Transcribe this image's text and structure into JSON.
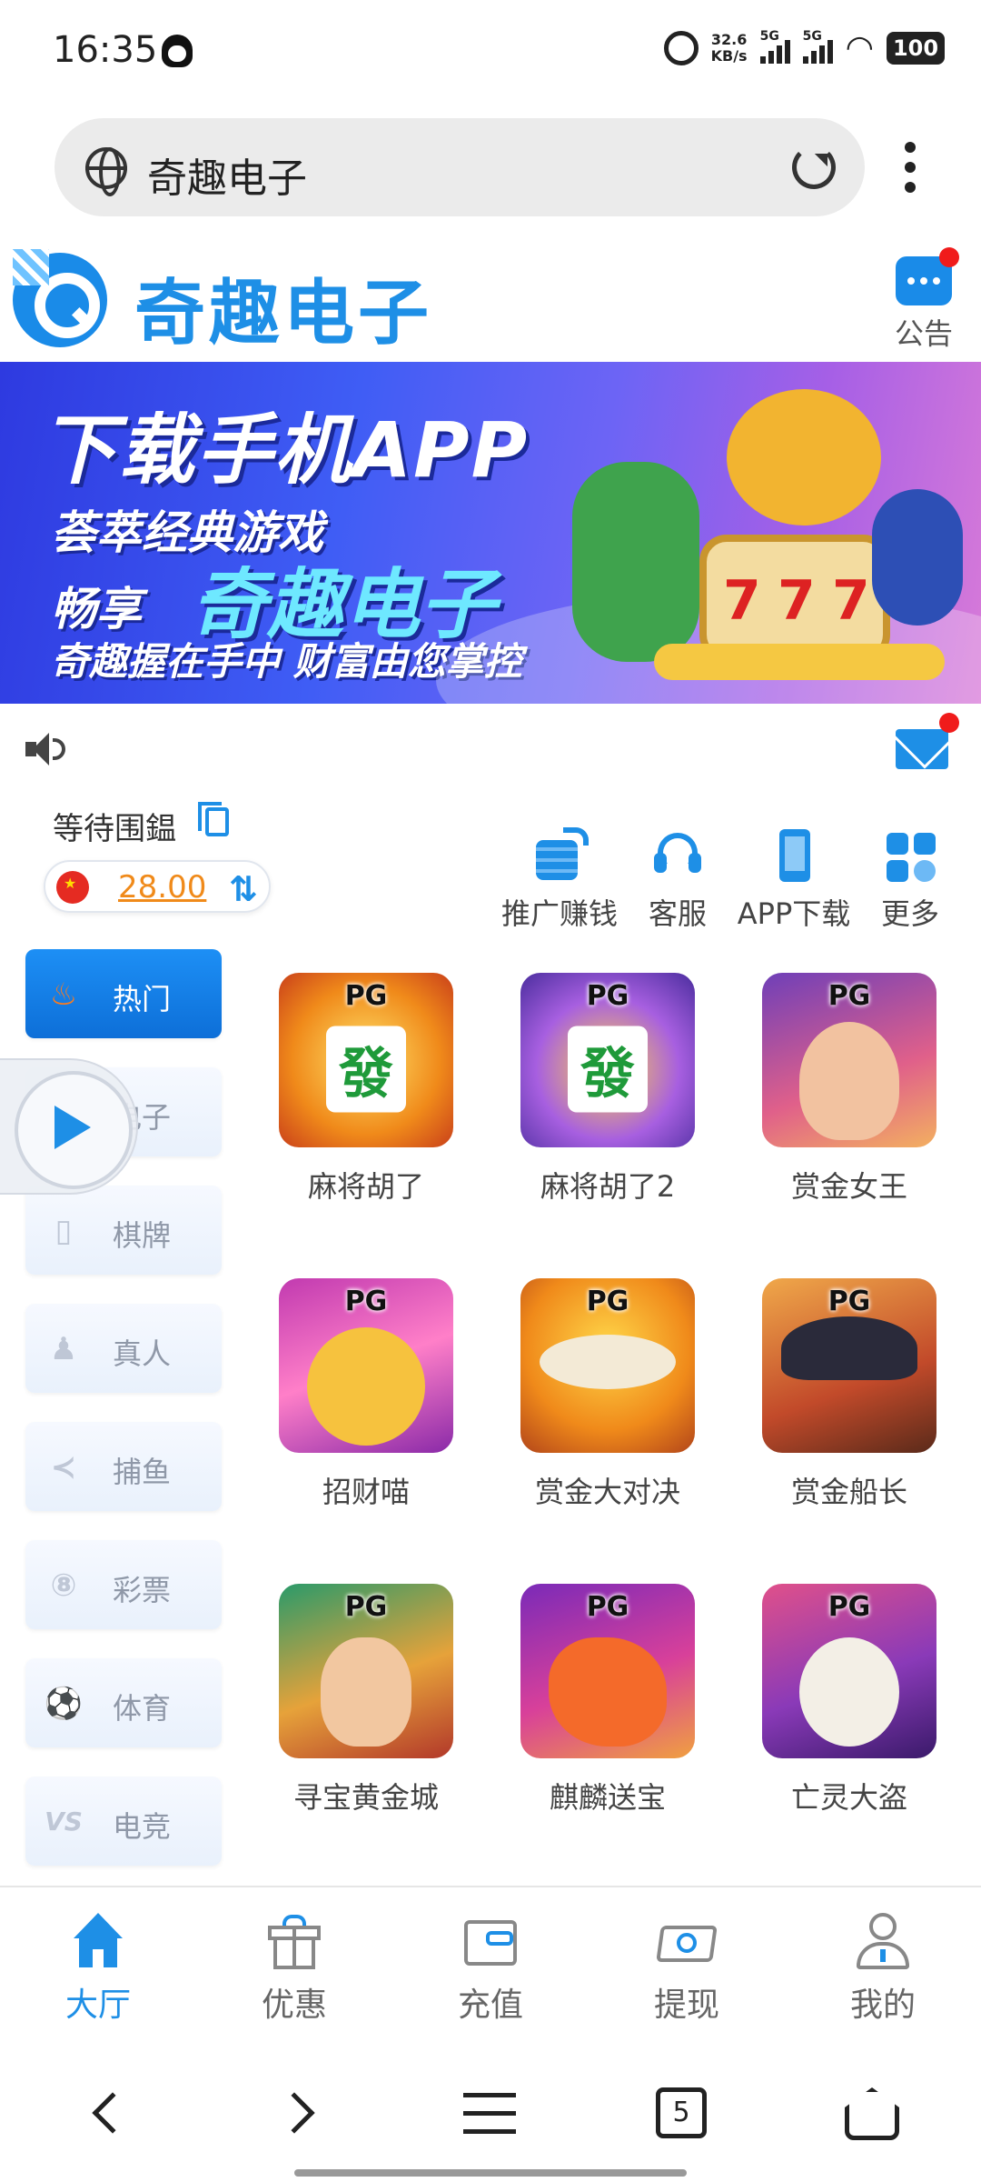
{
  "status_bar": {
    "time": "16:35",
    "net_speed_value": "32.6",
    "net_speed_unit": "KB/s",
    "sim1": "5G",
    "sim2": "5G",
    "battery": "100"
  },
  "browser": {
    "url_title": "奇趣电子"
  },
  "site": {
    "logo_text": "奇趣电子",
    "notice_label": "公告"
  },
  "banner": {
    "line1": "下载手机APP",
    "line2": "荟萃经典游戏",
    "line3_prefix": "畅享",
    "line3_brand": "奇趣电子",
    "line4": "奇趣握在手中  财富由您掌控",
    "slot_digits": [
      "7",
      "7",
      "7"
    ]
  },
  "user": {
    "name": "等待围鎾",
    "balance": "28.00"
  },
  "quick_actions": [
    {
      "label": "推广赚钱",
      "icon": "coins-share-icon"
    },
    {
      "label": "客服",
      "icon": "headset-icon"
    },
    {
      "label": "APP下载",
      "icon": "phone-icon"
    },
    {
      "label": "更多",
      "icon": "grid-icon"
    }
  ],
  "categories": [
    {
      "label": "热门",
      "icon": "fire-icon",
      "active": true
    },
    {
      "label": "电子",
      "icon": "slot-icon",
      "active": false
    },
    {
      "label": "棋牌",
      "icon": "cards-icon",
      "active": false
    },
    {
      "label": "真人",
      "icon": "dealer-icon",
      "active": false
    },
    {
      "label": "捕鱼",
      "icon": "fish-icon",
      "active": false
    },
    {
      "label": "彩票",
      "icon": "lottery-ball-icon",
      "active": false
    },
    {
      "label": "体育",
      "icon": "soccer-ball-icon",
      "active": false
    },
    {
      "label": "电竞",
      "icon": "vs-icon",
      "active": false
    }
  ],
  "games": [
    {
      "name": "麻将胡了",
      "badge": "PG",
      "tile": "發"
    },
    {
      "name": "麻将胡了2",
      "badge": "PG",
      "tile": "發"
    },
    {
      "name": "赏金女王",
      "badge": "PG"
    },
    {
      "name": "招财喵",
      "badge": "PG"
    },
    {
      "name": "赏金大对决",
      "badge": "PG"
    },
    {
      "name": "赏金船长",
      "badge": "PG"
    },
    {
      "name": "寻宝黄金城",
      "badge": "PG"
    },
    {
      "name": "麒麟送宝",
      "badge": "PG"
    },
    {
      "name": "亡灵大盗",
      "badge": "PG"
    }
  ],
  "tabs": [
    {
      "label": "大厅",
      "icon": "home-icon",
      "active": true
    },
    {
      "label": "优惠",
      "icon": "gift-icon",
      "active": false
    },
    {
      "label": "充值",
      "icon": "wallet-icon",
      "active": false
    },
    {
      "label": "提现",
      "icon": "withdraw-icon",
      "active": false
    },
    {
      "label": "我的",
      "icon": "user-icon",
      "active": false
    }
  ],
  "system_nav": {
    "tab_count": "5"
  },
  "colors": {
    "accent": "#1e8fe6",
    "badge_red": "#f01b1b",
    "balance_orange": "#f08a1a"
  }
}
